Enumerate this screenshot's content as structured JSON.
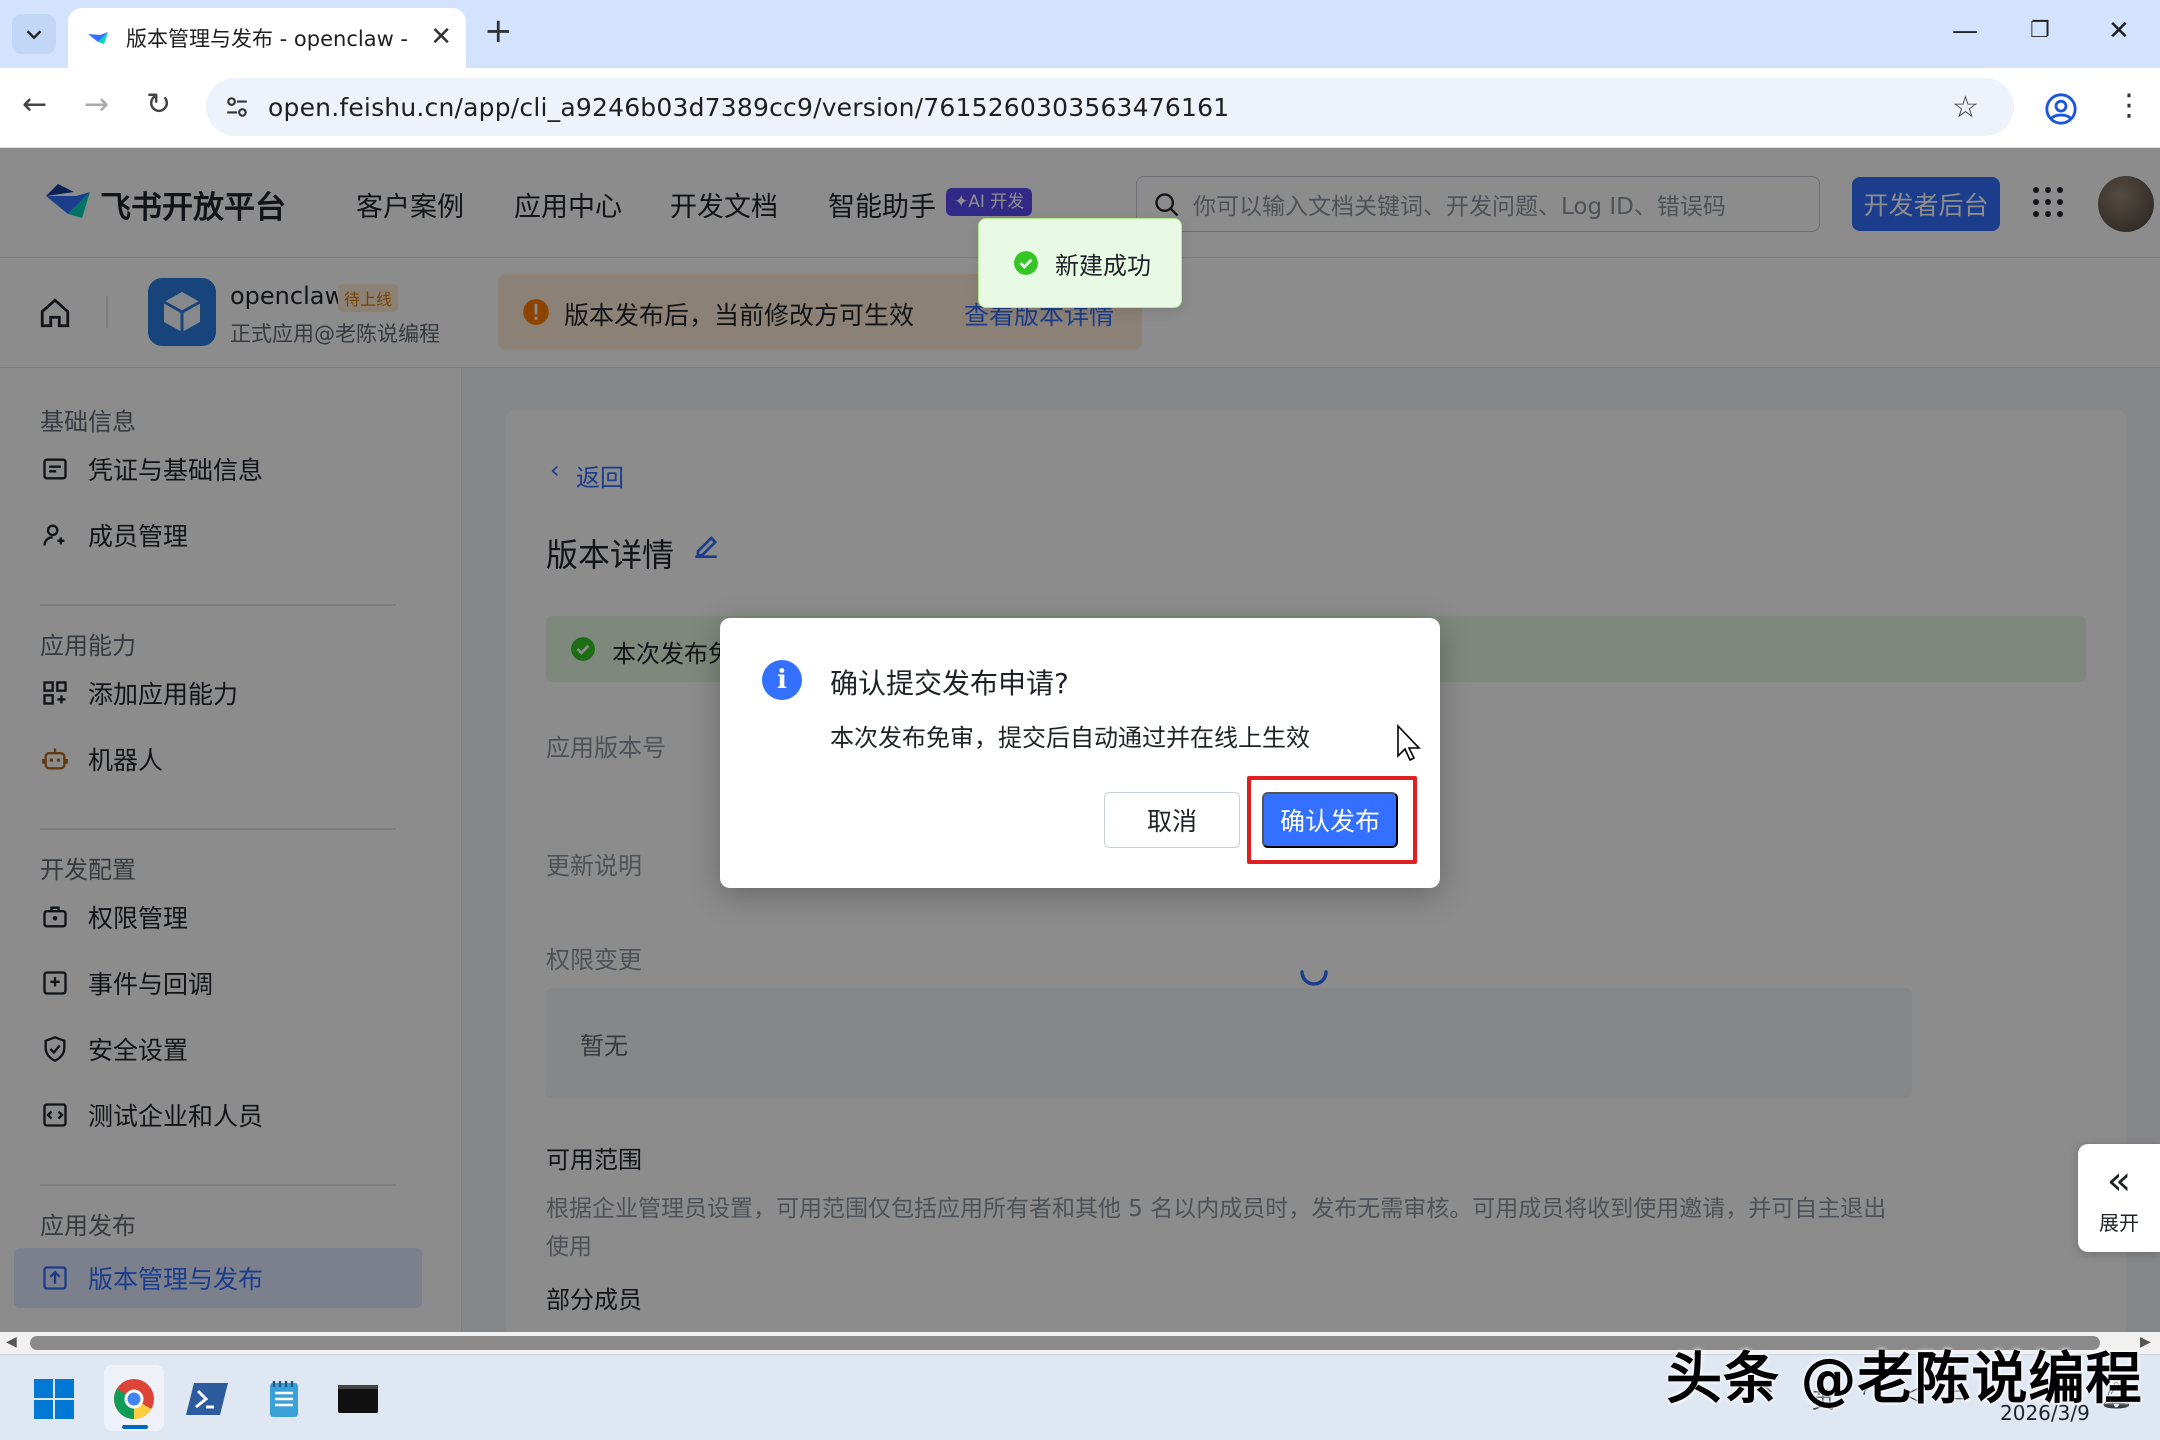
{
  "browser": {
    "tab_title": "版本管理与发布 - openclaw - ",
    "url": "open.feishu.cn/app/cli_a9246b03d7389cc9/version/7615260303563476161"
  },
  "header": {
    "logo": "飞书开放平台",
    "nav": [
      "客户案例",
      "应用中心",
      "开发文档",
      "智能助手"
    ],
    "ai_badge": "✦AI 开发",
    "search_placeholder": "你可以输入文档关键词、开发问题、Log ID、错误码",
    "dev_button": "开发者后台"
  },
  "app": {
    "name": "openclaw",
    "status": "待上线",
    "subtitle": "正式应用@老陈说编程",
    "notice": "版本发布后，当前修改方可生效",
    "notice_link": "查看版本详情"
  },
  "sidebar": {
    "sections": [
      {
        "title": "基础信息",
        "items": [
          "凭证与基础信息",
          "成员管理"
        ]
      },
      {
        "title": "应用能力",
        "items": [
          "添加应用能力",
          "机器人"
        ]
      },
      {
        "title": "开发配置",
        "items": [
          "权限管理",
          "事件与回调",
          "安全设置",
          "测试企业和人员"
        ]
      },
      {
        "title": "应用发布",
        "items": [
          "版本管理与发布"
        ]
      }
    ]
  },
  "main": {
    "back": "返回",
    "title": "版本详情",
    "banner": "本次发布免",
    "version_label": "应用版本号",
    "update_label": "更新说明",
    "perm_label": "权限变更",
    "perm_value": "暂无",
    "scope_label": "可用范围",
    "scope_desc": "根据企业管理员设置，可用范围仅包括应用所有者和其他 5 名以内成员时，发布无需审核。可用成员将收到使用邀请，并可自主退出使用",
    "partial": "部分成员"
  },
  "toast": "新建成功",
  "dialog": {
    "title": "确认提交发布申请?",
    "body": "本次发布免审，提交后自动通过并在线上生效",
    "cancel": "取消",
    "confirm": "确认发布"
  },
  "expand": "展开",
  "taskbar": {
    "date": "2026/3/9"
  },
  "watermark": "头条 @老陈说编程",
  "colors": {
    "accent": "#3370ff",
    "highlight": "#e02020",
    "toast_bg": "#e8fae3"
  }
}
